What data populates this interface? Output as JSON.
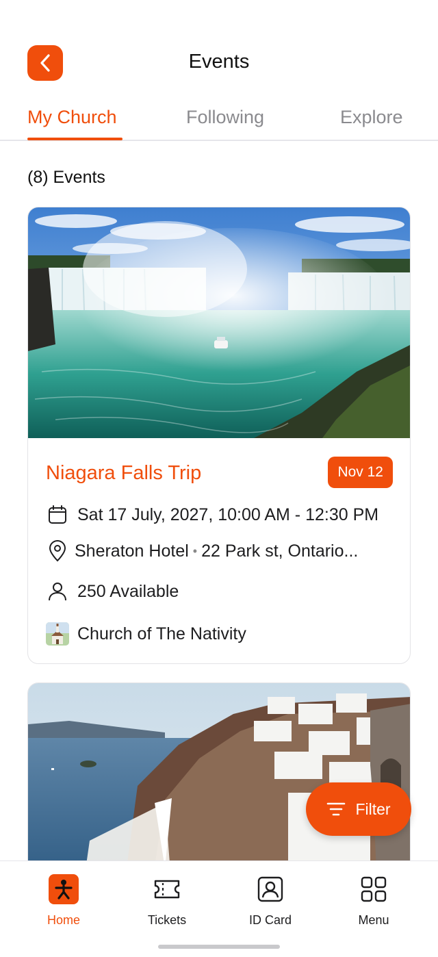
{
  "header": {
    "title": "Events"
  },
  "tabs": [
    {
      "label": "My Church",
      "active": true
    },
    {
      "label": "Following",
      "active": false
    },
    {
      "label": "Explore",
      "active": false
    }
  ],
  "events_count": "(8) Events",
  "events": [
    {
      "title": "Niagara Falls Trip",
      "badge": "Nov 12",
      "datetime": "Sat 17 July, 2027, 10:00 AM - 12:30 PM",
      "venue": "Sheraton Hotel",
      "address": "22 Park st, Ontario...",
      "availability": "250 Available",
      "church": "Church of The Nativity"
    }
  ],
  "filter_label": "Filter",
  "bottom_nav": [
    {
      "label": "Home",
      "icon": "home-icon",
      "active": true
    },
    {
      "label": "Tickets",
      "icon": "ticket-icon",
      "active": false
    },
    {
      "label": "ID Card",
      "icon": "id-card-icon",
      "active": false
    },
    {
      "label": "Menu",
      "icon": "grid-menu-icon",
      "active": false
    }
  ],
  "colors": {
    "accent": "#f04e0c",
    "text": "#1d1d1f",
    "muted": "#8a8a8e"
  }
}
